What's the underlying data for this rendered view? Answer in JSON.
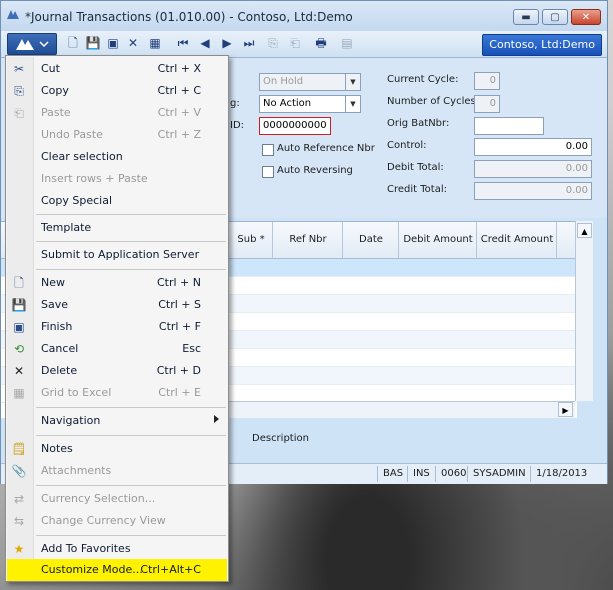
{
  "window": {
    "title": "*Journal Transactions (01.010.00) - Contoso, Ltd:Demo",
    "company": "Contoso, Ltd:Demo"
  },
  "form": {
    "status_value": "On Hold",
    "posting_label": "g:",
    "posting_value": "No Action",
    "id_label": "ID:",
    "id_value": "0000000000",
    "auto_ref_label": "Auto Reference Nbr",
    "auto_rev_label": "Auto Reversing",
    "current_cycle_label": "Current Cycle:",
    "current_cycle_value": "0",
    "num_cycles_label": "Number of Cycles:",
    "num_cycles_value": "0",
    "orig_batnbr_label": "Orig BatNbr:",
    "orig_batnbr_value": "",
    "control_label": "Control:",
    "control_value": "0.00",
    "debit_total_label": "Debit Total:",
    "debit_total_value": "0.00",
    "credit_total_label": "Credit Total:",
    "credit_total_value": "0.00"
  },
  "grid": {
    "columns": [
      "Sub *",
      "Ref Nbr",
      "Date",
      "Debit Amount",
      "Credit Amount"
    ],
    "description_label": "Description"
  },
  "status": {
    "cells": [
      "BAS",
      "INS",
      "0060",
      "SYSADMIN",
      "1/18/2013"
    ]
  },
  "menu": {
    "items": [
      {
        "label": "Cut",
        "shortcut": "Ctrl + X",
        "icon": "scissors-icon",
        "disabled": false
      },
      {
        "label": "Copy",
        "shortcut": "Ctrl + C",
        "icon": "copy-icon",
        "disabled": false
      },
      {
        "label": "Paste",
        "shortcut": "Ctrl + V",
        "icon": "paste-icon",
        "disabled": true
      },
      {
        "label": "Undo Paste",
        "shortcut": "Ctrl + Z",
        "icon": "",
        "disabled": true
      },
      {
        "label": "Clear selection",
        "shortcut": "",
        "icon": "",
        "disabled": false
      },
      {
        "label": "Insert rows + Paste",
        "shortcut": "",
        "icon": "",
        "disabled": true
      },
      {
        "label": "Copy Special",
        "shortcut": "",
        "icon": "",
        "disabled": false
      },
      {
        "label": "Template",
        "shortcut": "",
        "icon": "",
        "disabled": false
      },
      {
        "label": "Submit to Application Server",
        "shortcut": "",
        "icon": "",
        "disabled": false
      },
      {
        "label": "New",
        "shortcut": "Ctrl + N",
        "icon": "new-document-icon",
        "disabled": false
      },
      {
        "label": "Save",
        "shortcut": "Ctrl + S",
        "icon": "save-icon",
        "disabled": false
      },
      {
        "label": "Finish",
        "shortcut": "Ctrl + F",
        "icon": "finish-icon",
        "disabled": false
      },
      {
        "label": "Cancel",
        "shortcut": "Esc",
        "icon": "cancel-icon",
        "disabled": false
      },
      {
        "label": "Delete",
        "shortcut": "Ctrl + D",
        "icon": "delete-icon",
        "disabled": false
      },
      {
        "label": "Grid to Excel",
        "shortcut": "Ctrl + E",
        "icon": "excel-icon",
        "disabled": true
      },
      {
        "label": "Navigation",
        "shortcut": "",
        "icon": "",
        "disabled": false
      },
      {
        "label": "Notes",
        "shortcut": "",
        "icon": "notes-icon",
        "disabled": false
      },
      {
        "label": "Attachments",
        "shortcut": "",
        "icon": "attachments-icon",
        "disabled": true
      },
      {
        "label": "Currency Selection...",
        "shortcut": "",
        "icon": "currency-icon",
        "disabled": true
      },
      {
        "label": "Change Currency View",
        "shortcut": "",
        "icon": "currency-view-icon",
        "disabled": true
      },
      {
        "label": "Add To Favorites",
        "shortcut": "",
        "icon": "star-icon",
        "disabled": false
      },
      {
        "label": "Customize Mode...",
        "shortcut": "Ctrl+Alt+C",
        "icon": "",
        "disabled": false
      }
    ],
    "highlight_color": "#fff200"
  }
}
